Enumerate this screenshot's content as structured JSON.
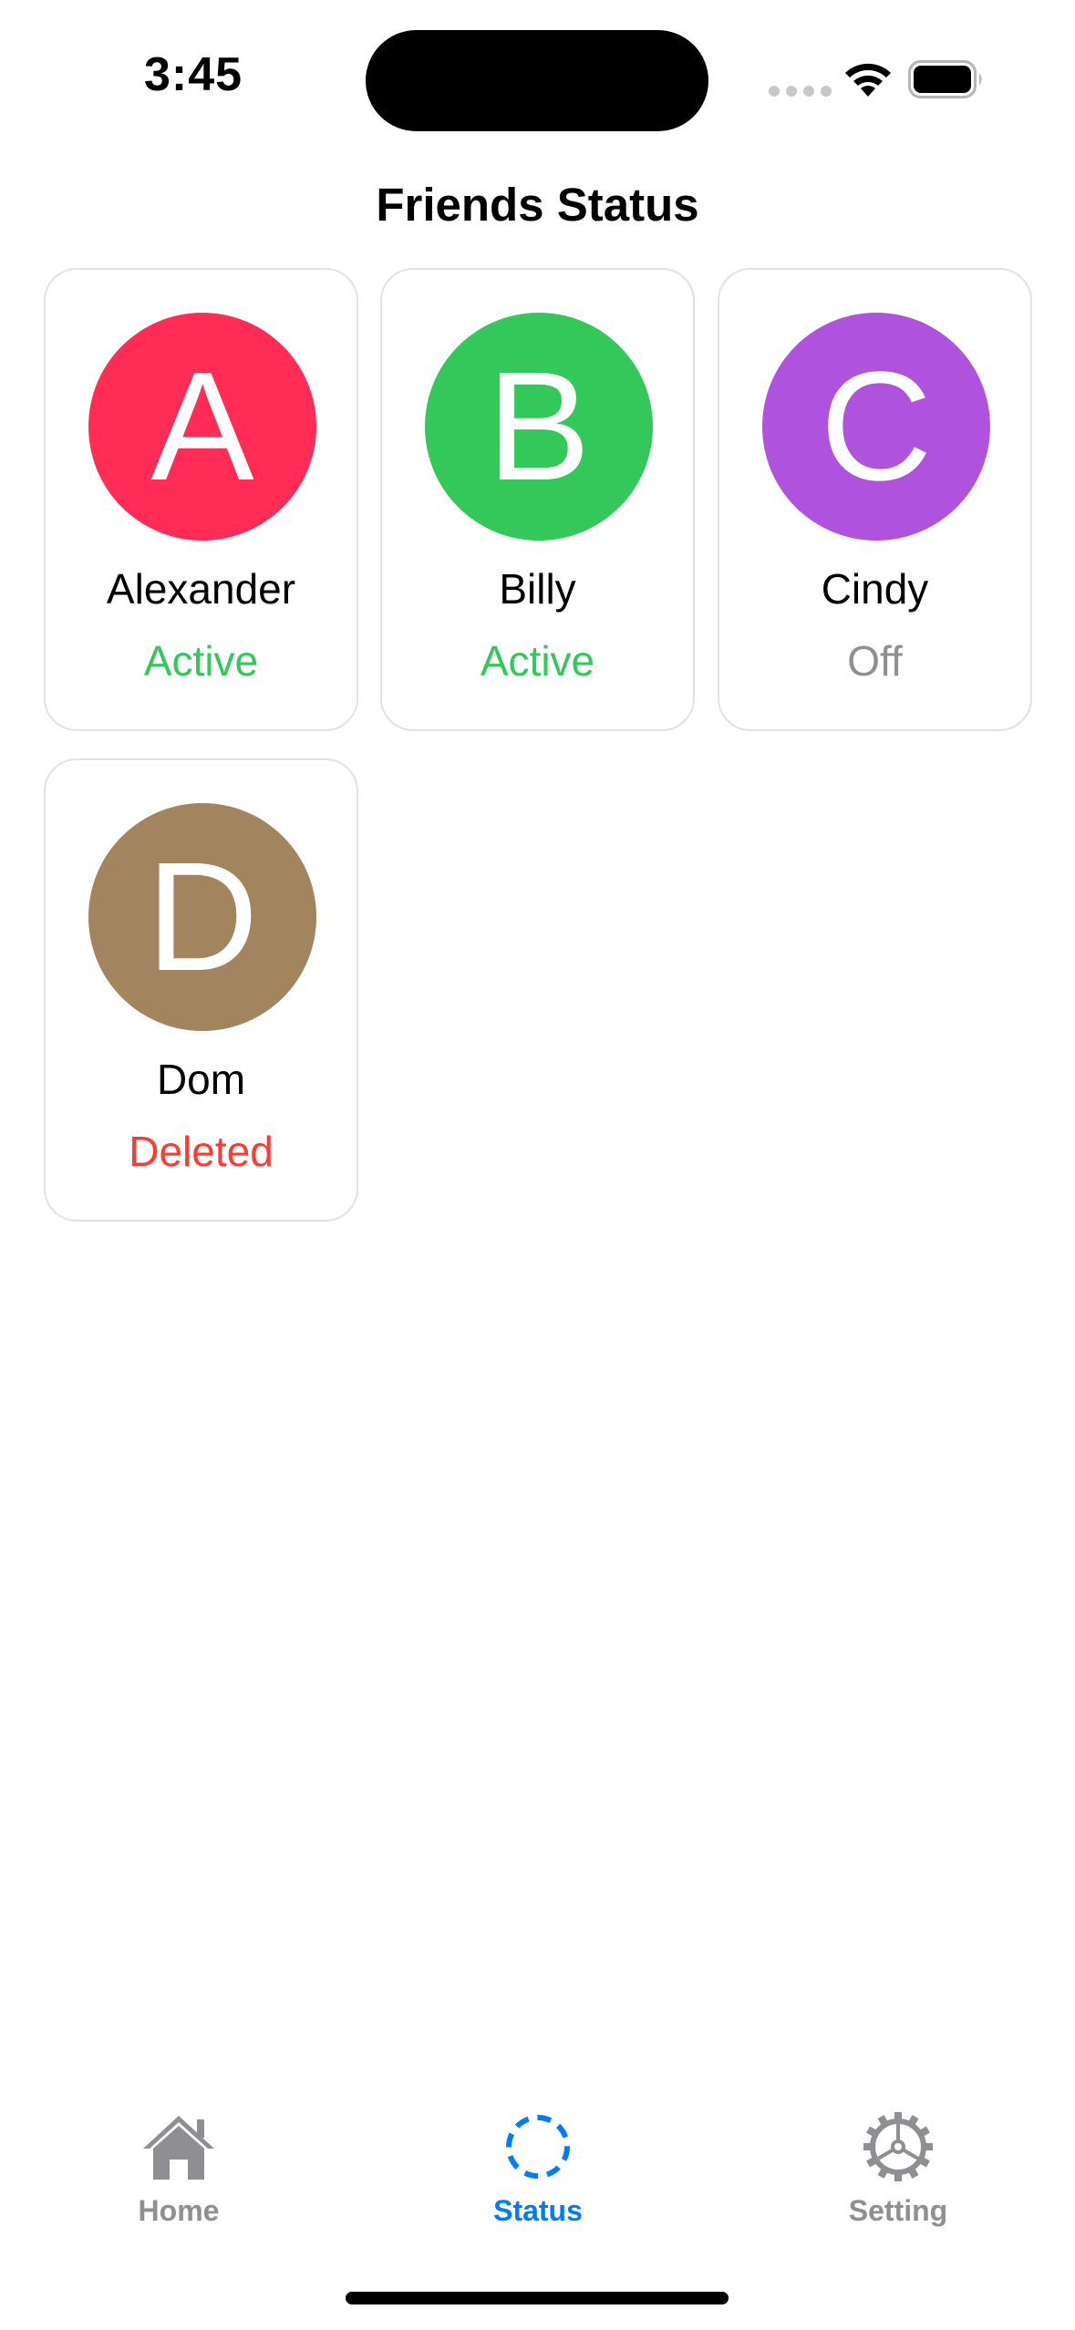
{
  "status_bar": {
    "time": "3:45"
  },
  "header": {
    "title": "Friends Status"
  },
  "friends": [
    {
      "initial": "A",
      "name": "Alexander",
      "status": "Active",
      "avatar_color": "#ff2d55",
      "status_color": "#34c759"
    },
    {
      "initial": "B",
      "name": "Billy",
      "status": "Active",
      "avatar_color": "#34c759",
      "status_color": "#34c759"
    },
    {
      "initial": "C",
      "name": "Cindy",
      "status": "Off",
      "avatar_color": "#af52de",
      "status_color": "#8e8e93"
    },
    {
      "initial": "D",
      "name": "Dom",
      "status": "Deleted",
      "avatar_color": "#a2845e",
      "status_color": "#ff3b30"
    }
  ],
  "tab_bar": {
    "active_color": "#007aff",
    "inactive_color": "#8e8e93",
    "tabs": [
      {
        "label": "Home",
        "icon": "house-icon",
        "active": false
      },
      {
        "label": "Status",
        "icon": "dashed-circle-icon",
        "active": true
      },
      {
        "label": "Setting",
        "icon": "gear-icon",
        "active": false
      }
    ]
  }
}
